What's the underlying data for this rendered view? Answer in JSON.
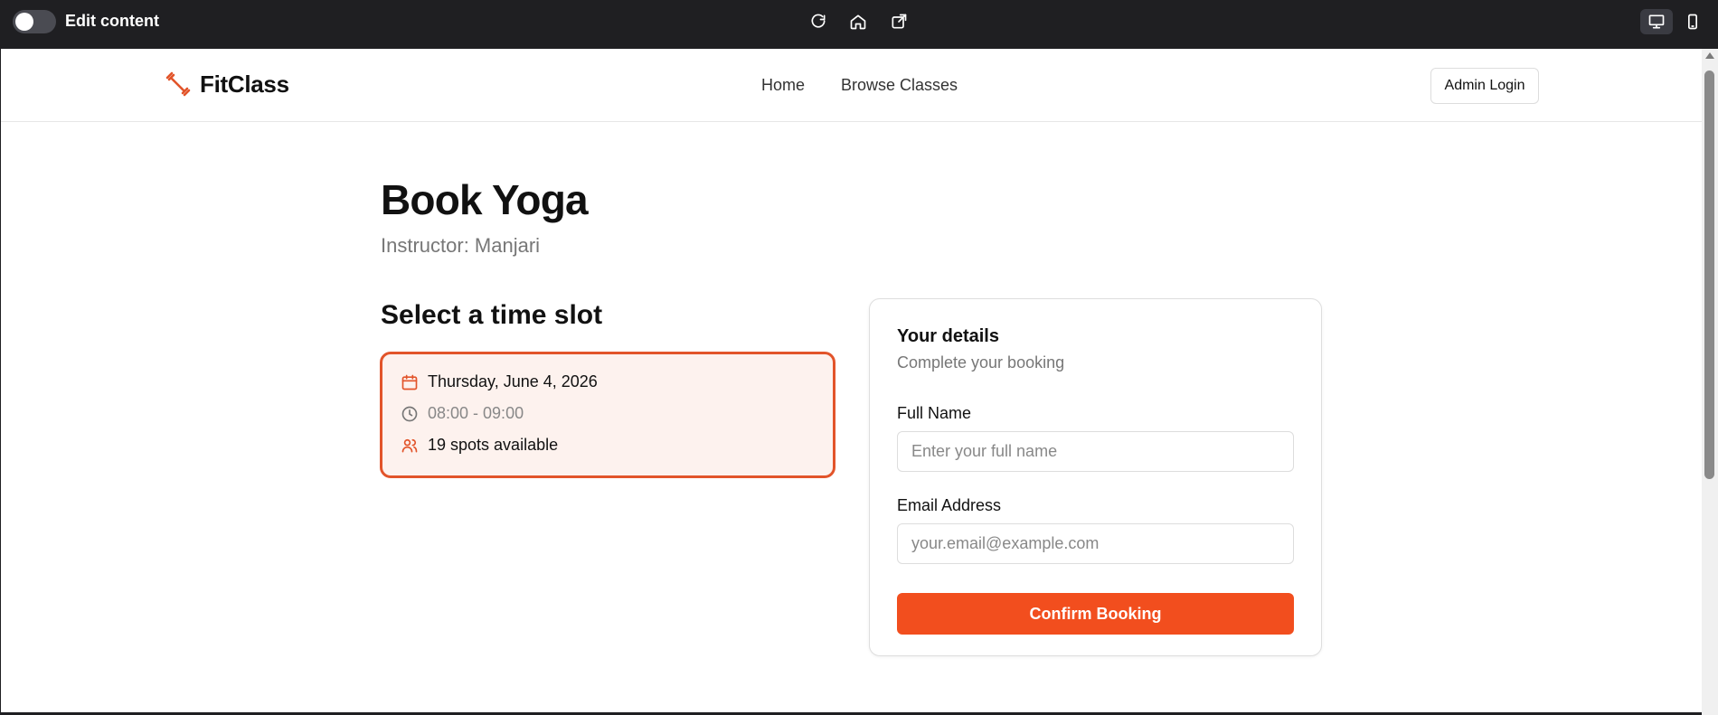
{
  "toolbar": {
    "edit_label": "Edit content",
    "icons": [
      "reload-icon",
      "home-icon",
      "external-link-icon",
      "desktop-icon",
      "mobile-icon"
    ]
  },
  "header": {
    "brand": "FitClass",
    "nav": [
      {
        "label": "Home"
      },
      {
        "label": "Browse Classes"
      }
    ],
    "admin_button": "Admin Login"
  },
  "main": {
    "title": "Book Yoga",
    "subtitle": "Instructor: Manjari",
    "slot_section_title": "Select a time slot",
    "slot": {
      "date": "Thursday, June 4, 2026",
      "time": "08:00 - 09:00",
      "spots": "19 spots available"
    }
  },
  "form": {
    "title": "Your details",
    "subtitle": "Complete your booking",
    "name_label": "Full Name",
    "name_placeholder": "Enter your full name",
    "email_label": "Email Address",
    "email_placeholder": "your.email@example.com",
    "submit": "Confirm Booking"
  },
  "colors": {
    "accent": "#f24e1e",
    "accent_border": "#e2542a",
    "slot_bg": "#fdf2ee",
    "toolbar_bg": "#1f1f22"
  }
}
